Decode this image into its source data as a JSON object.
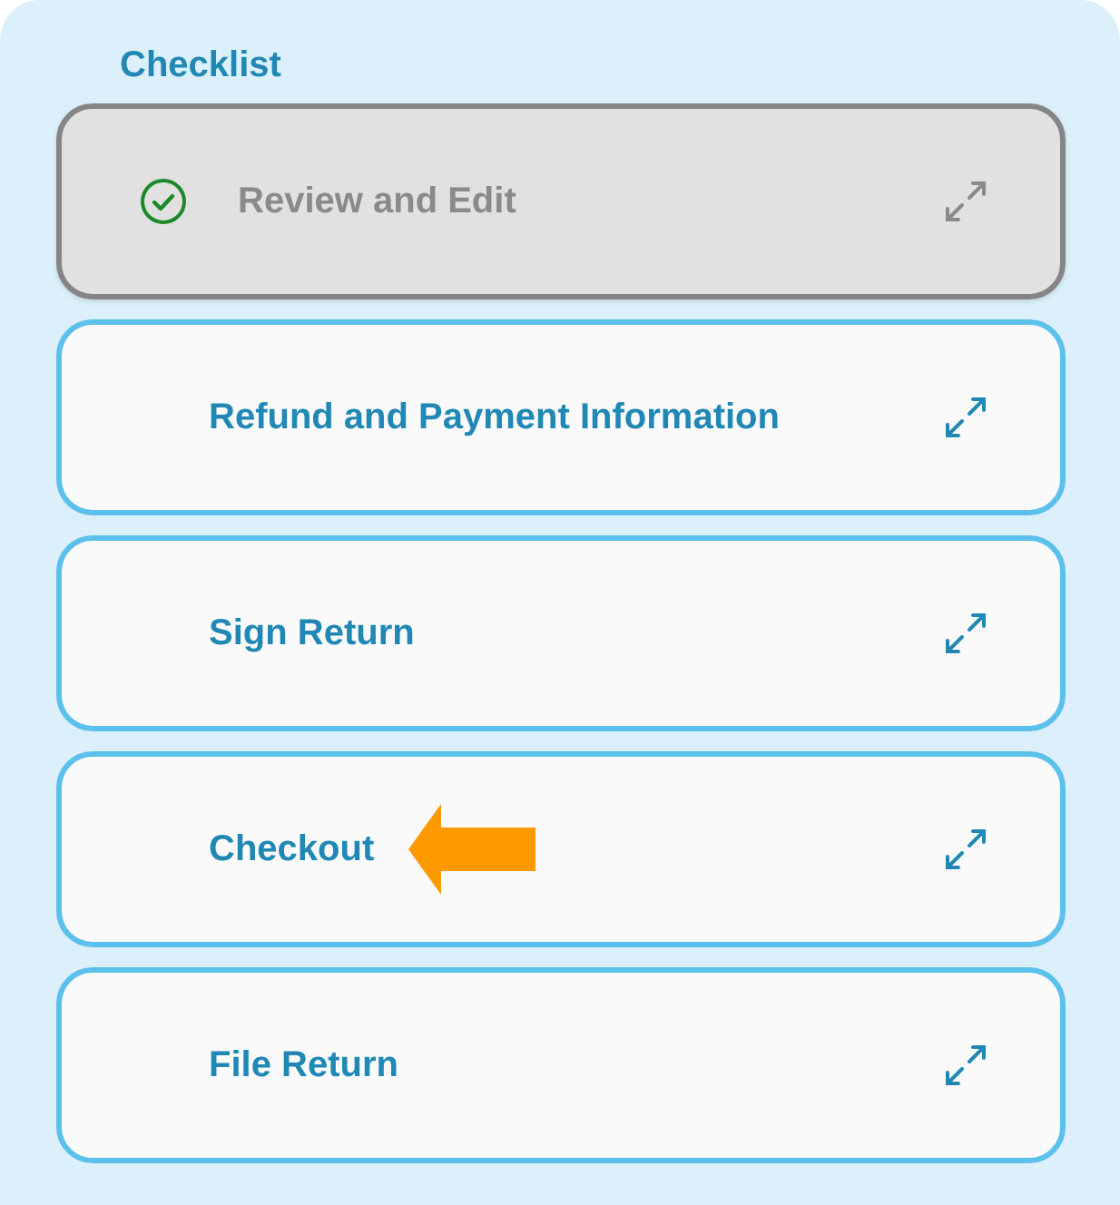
{
  "title": "Checklist",
  "items": [
    {
      "label": "Review and Edit",
      "completed": true,
      "pointed_at": false
    },
    {
      "label": "Refund and Payment Information",
      "completed": false,
      "pointed_at": false
    },
    {
      "label": "Sign Return",
      "completed": false,
      "pointed_at": false
    },
    {
      "label": "Checkout",
      "completed": false,
      "pointed_at": true
    },
    {
      "label": "File Return",
      "completed": false,
      "pointed_at": false
    }
  ]
}
